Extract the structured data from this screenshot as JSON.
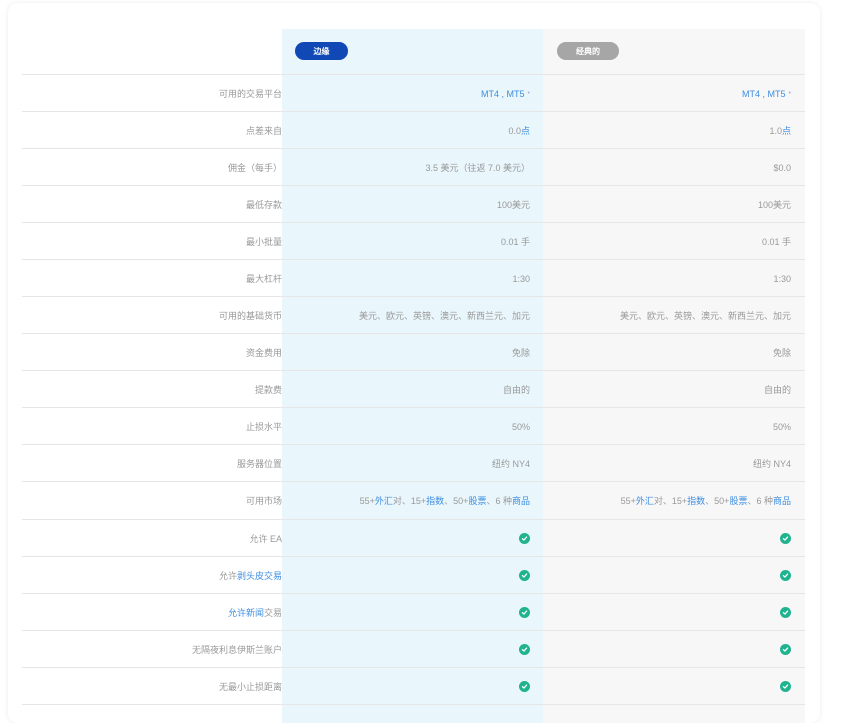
{
  "header": {
    "edge_label": "边缘",
    "classic_label": "经典的"
  },
  "rows": [
    {
      "label": "可用的交易平台",
      "edge": "MT4 , MT5",
      "classic": "MT4 , MT5",
      "dot": "•"
    },
    {
      "label": "点差来自",
      "edge_num": "0.0",
      "edge_unit": "点",
      "classic_num": "1.0",
      "classic_unit": "点"
    },
    {
      "label": "佣金（每手）",
      "edge": "3.5 美元（往返 7.0 美元）",
      "classic": "$0.0"
    },
    {
      "label": "最低存款",
      "edge": "100美元",
      "classic": "100美元"
    },
    {
      "label": "最小批量",
      "edge": "0.01 手",
      "classic": "0.01 手"
    },
    {
      "label": "最大杠杆",
      "edge": "1:30",
      "classic": "1:30"
    },
    {
      "label": "可用的基础货币",
      "edge": "美元、欧元、英镑、澳元、新西兰元、加元",
      "classic": "美元、欧元、英镑、澳元、新西兰元、加元"
    },
    {
      "label": "资金费用",
      "edge": "免除",
      "classic": "免除"
    },
    {
      "label": "提款费",
      "edge": "自由的",
      "classic": "自由的"
    },
    {
      "label": "止损水平",
      "edge": "50%",
      "classic": "50%"
    },
    {
      "label": "服务器位置",
      "edge": "纽约 NY4",
      "classic": "纽约 NY4"
    },
    {
      "label": "可用市场",
      "m1": "55+",
      "m2": "外汇",
      "m3": "对、15+",
      "m4": "指数",
      "m5": "、50+",
      "m6": "股票",
      "m7": "、6 种",
      "m8": "商品"
    },
    {
      "label": "允许 EA"
    },
    {
      "label_pre": "允许",
      "label_link": "剥头皮交易"
    },
    {
      "label_link": "允许新闻",
      "label_post": "交易"
    },
    {
      "label": "无隔夜利息伊斯兰账户"
    },
    {
      "label": "无最小止损距离"
    }
  ],
  "colors": {
    "edge_badge": "#1048b6",
    "classic_badge": "#a6a6a6",
    "check": "#20b38f",
    "link": "#3d8de0"
  },
  "icons": {
    "check": "check-circle-icon"
  }
}
